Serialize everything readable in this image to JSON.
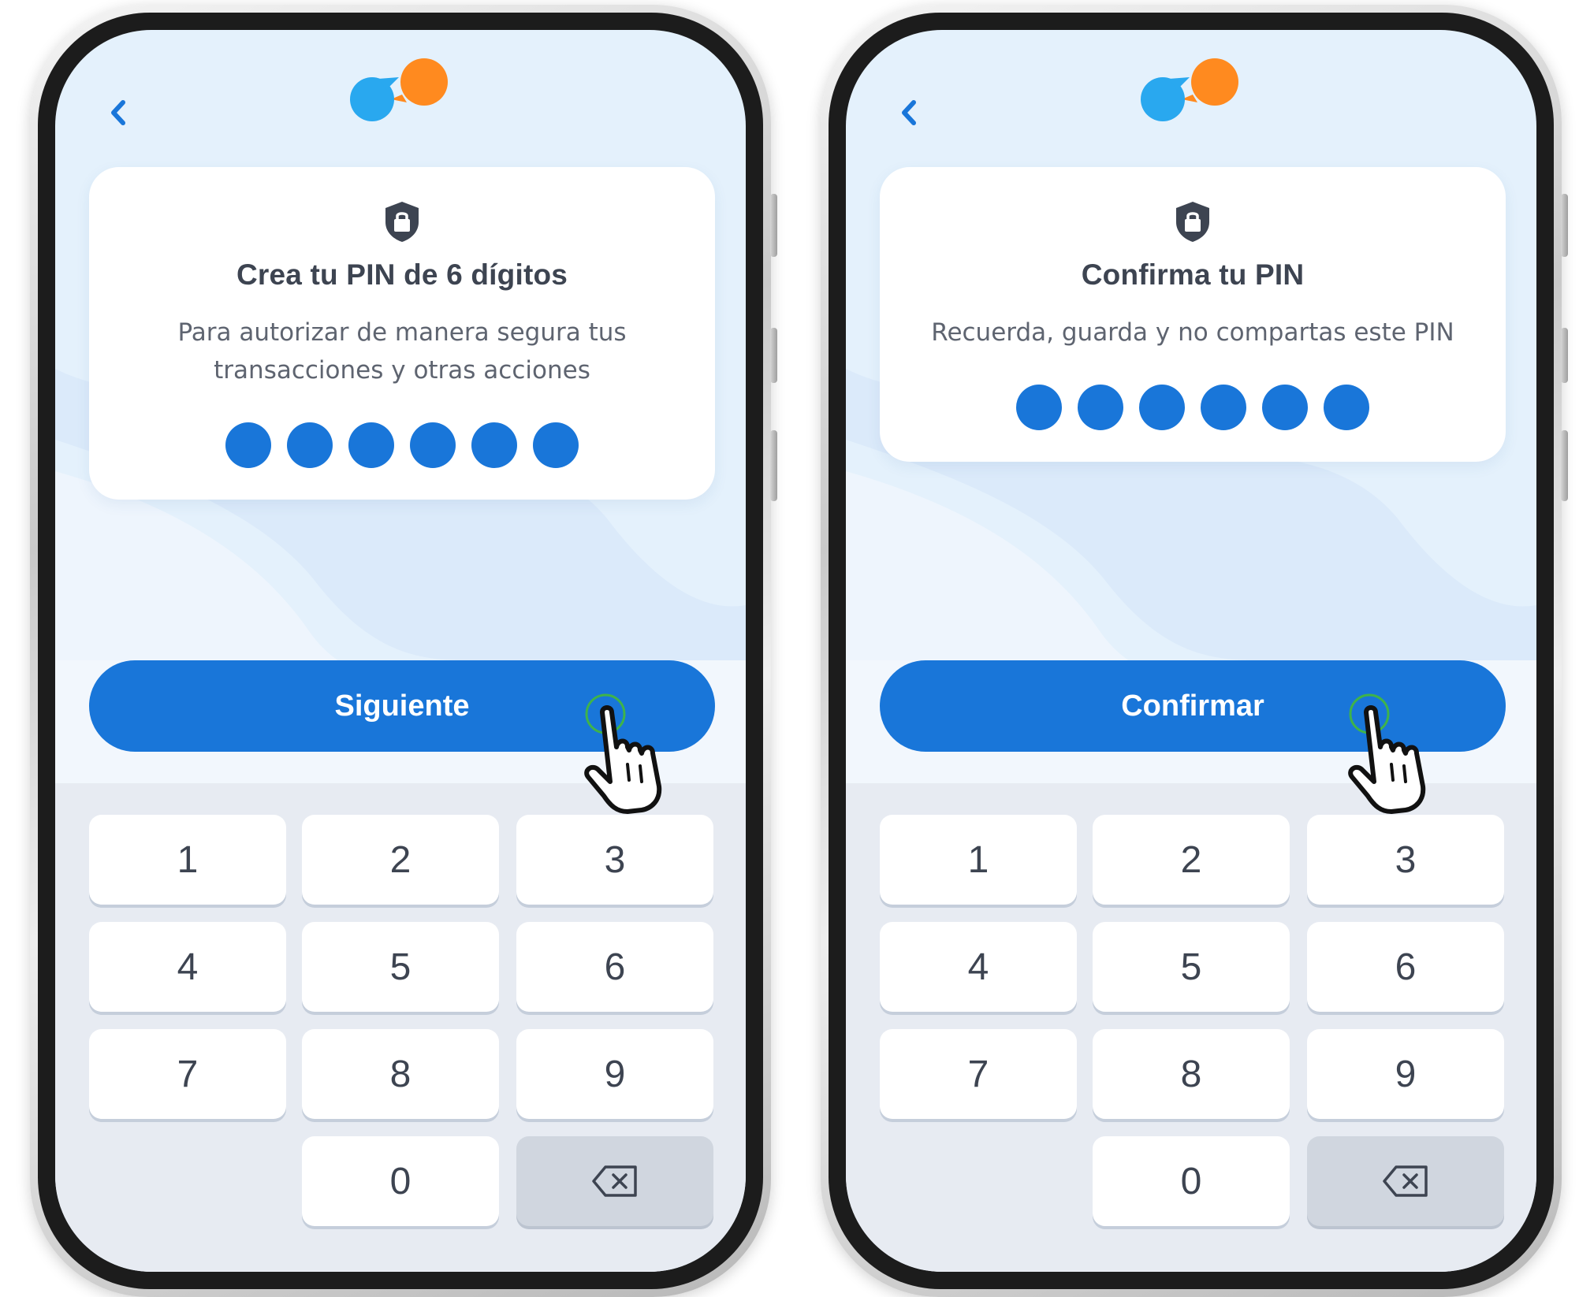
{
  "colors": {
    "primary": "#1976d9",
    "screen_bg": "#e4f1fc",
    "keypad_bg": "#e7ebf2",
    "text_dark": "#3d4451",
    "text_muted": "#5e6470",
    "logo_blue": "#29a8ef",
    "logo_orange": "#ff8a1f"
  },
  "screens": [
    {
      "back_icon": "chevron-left-icon",
      "logo_icon": "chat-bubbles-logo",
      "card": {
        "icon": "shield-lock-icon",
        "title": "Crea tu PIN de 6 dígitos",
        "subtitle_line1": "Para autorizar de manera segura tus",
        "subtitle_line2": "transacciones y otras acciones",
        "pin_length": 6,
        "pin_filled": 6
      },
      "primary_button": "Siguiente",
      "keypad": [
        "1",
        "2",
        "3",
        "4",
        "5",
        "6",
        "7",
        "8",
        "9",
        "0"
      ],
      "delete_icon": "backspace-icon"
    },
    {
      "back_icon": "chevron-left-icon",
      "logo_icon": "chat-bubbles-logo",
      "card": {
        "icon": "shield-lock-icon",
        "title": "Confirma tu PIN",
        "subtitle_line1": "Recuerda, guarda y no compartas este PIN",
        "pin_length": 6,
        "pin_filled": 6
      },
      "primary_button": "Confirmar",
      "keypad": [
        "1",
        "2",
        "3",
        "4",
        "5",
        "6",
        "7",
        "8",
        "9",
        "0"
      ],
      "delete_icon": "backspace-icon"
    }
  ]
}
